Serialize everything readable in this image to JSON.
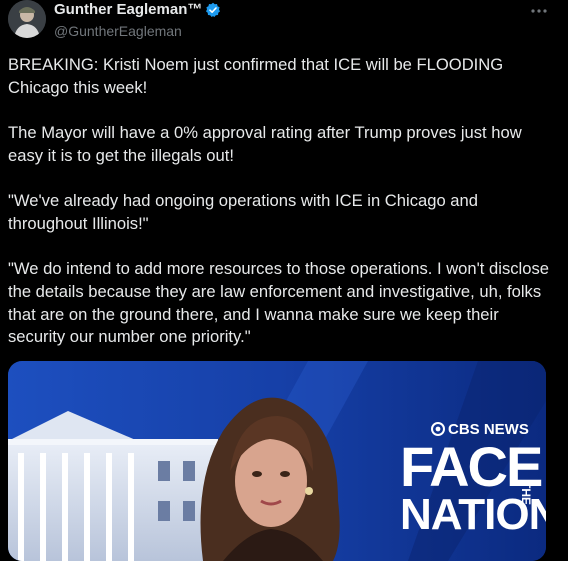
{
  "author": {
    "display_name": "Gunther Eagleman™",
    "handle": "@GuntherEagleman",
    "verified": true,
    "avatar_icon": "avatar-portrait-icon"
  },
  "post": {
    "paragraphs": [
      "BREAKING: Kristi Noem just confirmed that ICE will be FLOODING Chicago this week!",
      "The Mayor will have a 0% approval rating after Trump proves just how easy it is to get the illegals out!",
      "\"We've already had ongoing operations with ICE in Chicago and throughout Illinois!\"",
      "\"We do intend to add more resources to those operations. I won't disclose the details because they are law enforcement and investigative, uh, folks that are on the ground there, and I wanna make sure we keep their security our number one priority.\""
    ]
  },
  "media": {
    "network": "CBS NEWS",
    "show_face": "FACE",
    "show_the": "THE",
    "show_nation": "NATION"
  },
  "colors": {
    "background": "#000000",
    "text": "#e7e9ea",
    "muted": "#71767b",
    "verified_badge": "#1d9bf0",
    "media_blue": "#1640a8"
  }
}
